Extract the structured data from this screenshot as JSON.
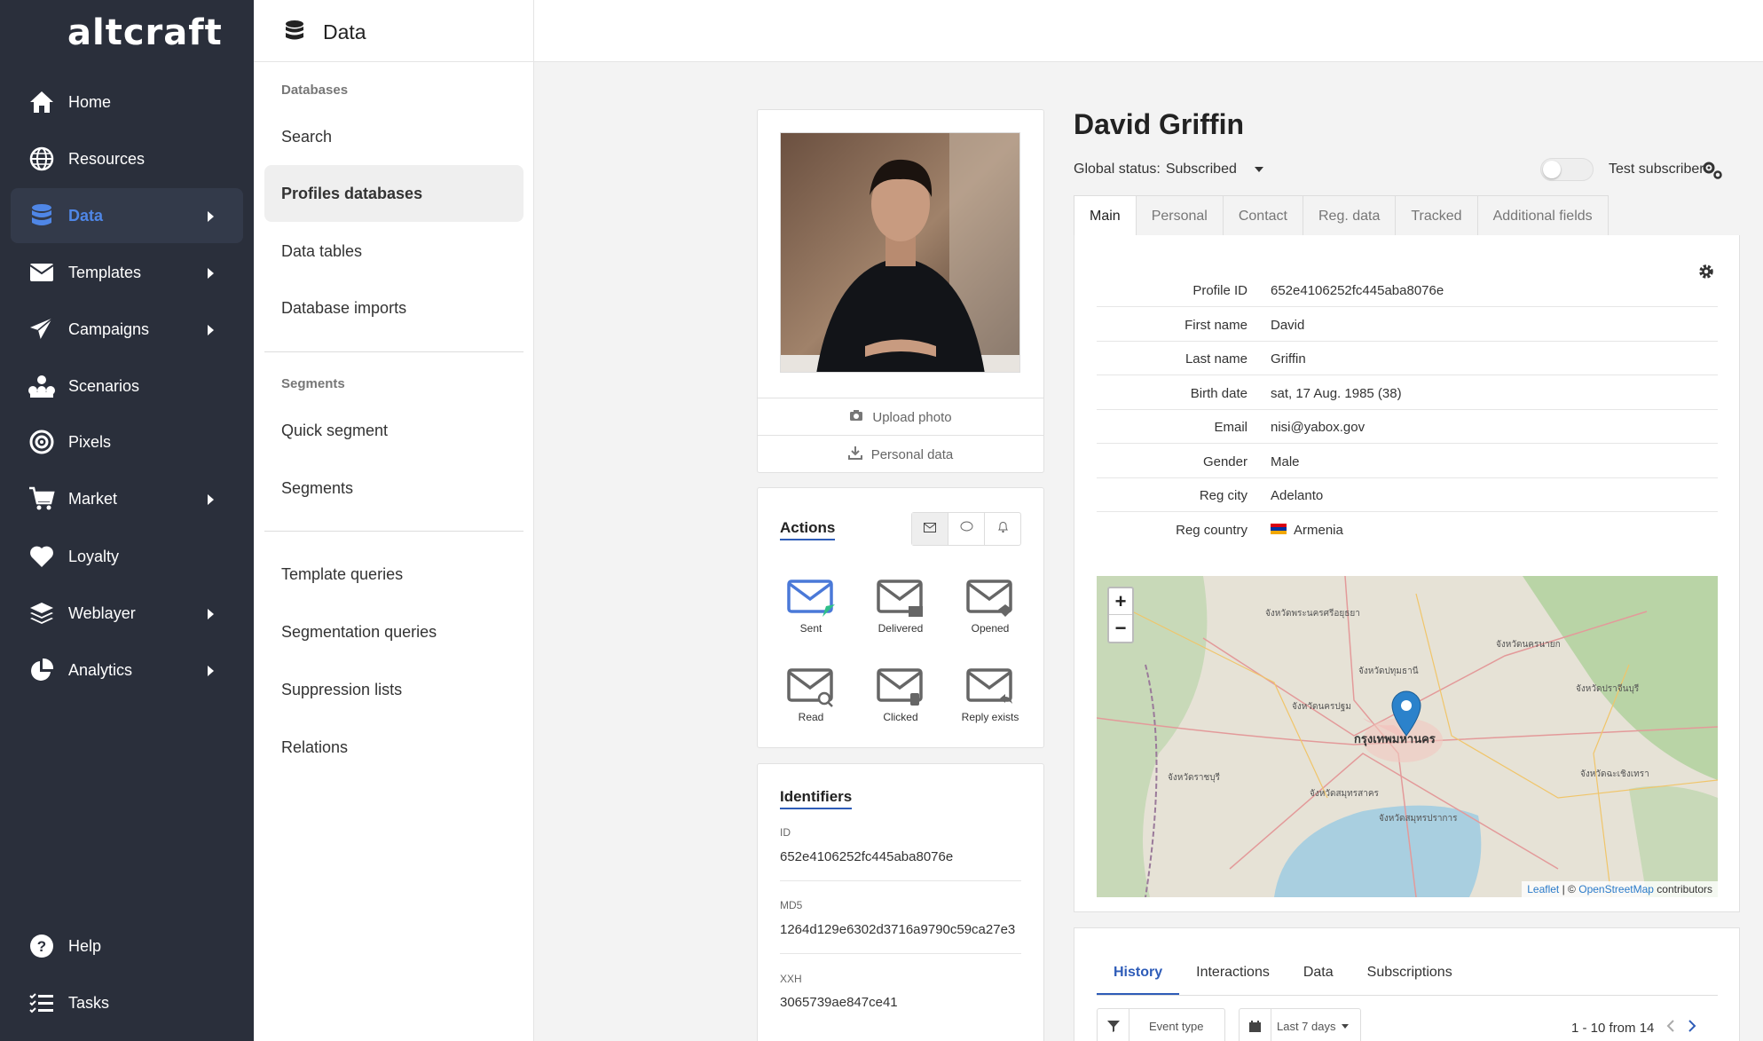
{
  "app": {
    "logo": "altcraft"
  },
  "nav": {
    "items": [
      {
        "label": "Home",
        "icon": "home-icon",
        "arrow": false,
        "active": false
      },
      {
        "label": "Resources",
        "icon": "globe-icon",
        "arrow": false,
        "active": false
      },
      {
        "label": "Data",
        "icon": "database-icon",
        "arrow": true,
        "active": true
      },
      {
        "label": "Templates",
        "icon": "envelope-icon",
        "arrow": true,
        "active": false
      },
      {
        "label": "Campaigns",
        "icon": "paper-plane-icon",
        "arrow": true,
        "active": false
      },
      {
        "label": "Scenarios",
        "icon": "sitemap-icon",
        "arrow": false,
        "active": false
      },
      {
        "label": "Pixels",
        "icon": "target-icon",
        "arrow": false,
        "active": false
      },
      {
        "label": "Market",
        "icon": "cart-icon",
        "arrow": true,
        "active": false
      },
      {
        "label": "Loyalty",
        "icon": "heart-icon",
        "arrow": false,
        "active": false
      },
      {
        "label": "Weblayer",
        "icon": "layers-icon",
        "arrow": true,
        "active": false
      },
      {
        "label": "Analytics",
        "icon": "pie-chart-icon",
        "arrow": true,
        "active": false
      }
    ],
    "help": "Help",
    "tasks": "Tasks"
  },
  "sub": {
    "title": "Data",
    "sections": {
      "databases": "Databases",
      "segments": "Segments"
    },
    "items": {
      "search": "Search",
      "profiles": "Profiles databases",
      "tables": "Data tables",
      "imports": "Database imports",
      "quick": "Quick segment",
      "segments": "Segments",
      "tq": "Template queries",
      "sq": "Segmentation queries",
      "sup": "Suppression lists",
      "rel": "Relations"
    }
  },
  "photo_card": {
    "upload": "Upload photo",
    "personal": "Personal data"
  },
  "actions": {
    "title": "Actions",
    "items": [
      "Sent",
      "Delivered",
      "Opened",
      "Read",
      "Clicked",
      "Reply exists"
    ]
  },
  "identifiers": {
    "title": "Identifiers",
    "items": [
      {
        "label": "ID",
        "value": "652e4106252fc445aba8076e"
      },
      {
        "label": "MD5",
        "value": "1264d129e6302d3716a9790c59ca27e3"
      },
      {
        "label": "XXH",
        "value": "3065739ae847ce41"
      }
    ]
  },
  "profile": {
    "name": "David Griffin",
    "global_status_label": "Global status:",
    "global_status": "Subscribed",
    "test_subscriber": "Test subscriber",
    "tabs": [
      "Main",
      "Personal",
      "Contact",
      "Reg. data",
      "Tracked",
      "Additional fields"
    ],
    "fields": [
      {
        "key": "Profile ID",
        "value": "652e4106252fc445aba8076e"
      },
      {
        "key": "First name",
        "value": "David"
      },
      {
        "key": "Last name",
        "value": "Griffin"
      },
      {
        "key": "Birth date",
        "value": "sat, 17 Aug. 1985 (38)"
      },
      {
        "key": "Email",
        "value": "nisi@yabox.gov"
      },
      {
        "key": "Gender",
        "value": "Male"
      },
      {
        "key": "Reg city",
        "value": "Adelanto"
      },
      {
        "key": "Reg country",
        "value": "Armenia"
      }
    ]
  },
  "map": {
    "zoom_in": "+",
    "zoom_out": "−",
    "attr_leaflet": "Leaflet",
    "attr_sep": "| ©",
    "attr_osm": "OpenStreetMap",
    "attr_rest": "contributors",
    "labels": [
      "จังหวัดพระนครศรีอยุธยา",
      "จังหวัดปทุมธานี",
      "จังหวัดนครปฐม",
      "กรุงเทพมหานคร",
      "จังหวัดสมุทรสาคร",
      "จังหวัดสมุทรปราการ",
      "จังหวัดราชบุรี",
      "จังหวัดฉะเชิงเทรา",
      "จังหวัดปราจีนบุรี",
      "จังหวัดนครนายก"
    ]
  },
  "history": {
    "tabs": [
      "History",
      "Interactions",
      "Data",
      "Subscriptions"
    ],
    "event_type": "Event type",
    "period": "Last 7 days",
    "pager": "1 - 10 from 14"
  }
}
